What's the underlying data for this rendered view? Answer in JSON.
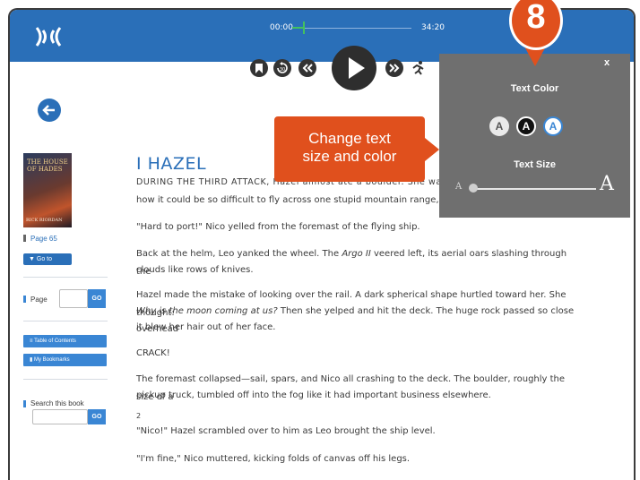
{
  "player": {
    "time_start": "00:00",
    "time_end": "34:20",
    "progress": 0.09
  },
  "sidebar": {
    "page_info": "Page 65",
    "goto_label": "▼ Go to",
    "page_label": "Page",
    "go_label": "GO",
    "toc_label": "Table of Contents",
    "bookmarks_label": "My Bookmarks",
    "search_label": "Search this book",
    "search_go_label": "GO"
  },
  "book": {
    "cover_title": "THE HOUSE OF HADES",
    "cover_author": "RICK RIORDAN"
  },
  "content": {
    "chapter_title": "I HAZEL",
    "line1": "DURING THE THIRD ATTACK, Hazel almost ate a boulder. She was pee",
    "line1b": "how it could be so difficult to fly across one stupid mountain range, when",
    "p2": "\"Hard to port!\" Nico yelled from the foremast of the flying ship.",
    "p3a": "Back at the helm, Leo yanked the wheel. The ",
    "p3_italic": "Argo II",
    "p3b": " veered left, its aerial oars slashing through the",
    "p3c": "clouds like rows of knives.",
    "p4a": "Hazel made the mistake of looking over the rail. A dark spherical shape hurtled toward her. She thought:",
    "p4_italic": "Why is the moon coming at us?",
    "p4b": " Then she yelped and hit the deck. The huge rock passed so close overhead",
    "p4c": "it blew her hair out of her face.",
    "p5": "CRACK!",
    "p6a": "The foremast collapsed—sail, spars, and Nico all crashing to the deck. The boulder, roughly the size of a",
    "p6b": "pickup truck, tumbled off into the fog like it had important business elsewhere.",
    "page_num": "2",
    "p7": "\"Nico!\" Hazel scrambled over to him as Leo brought the ship level.",
    "p8": "\"I'm fine,\" Nico muttered, kicking folds of canvas off his legs."
  },
  "panel": {
    "close": "x",
    "text_color_label": "Text Color",
    "text_size_label": "Text Size",
    "swatch_letter": "A",
    "small_a": "A",
    "big_a": "A"
  },
  "callout": {
    "line1": "Change text",
    "line2": "size and color"
  },
  "badge": {
    "number": "8"
  },
  "colors": {
    "brand_blue": "#2a6fb8",
    "accent_orange": "#e0501d",
    "panel_gray": "#6f6f6f"
  }
}
